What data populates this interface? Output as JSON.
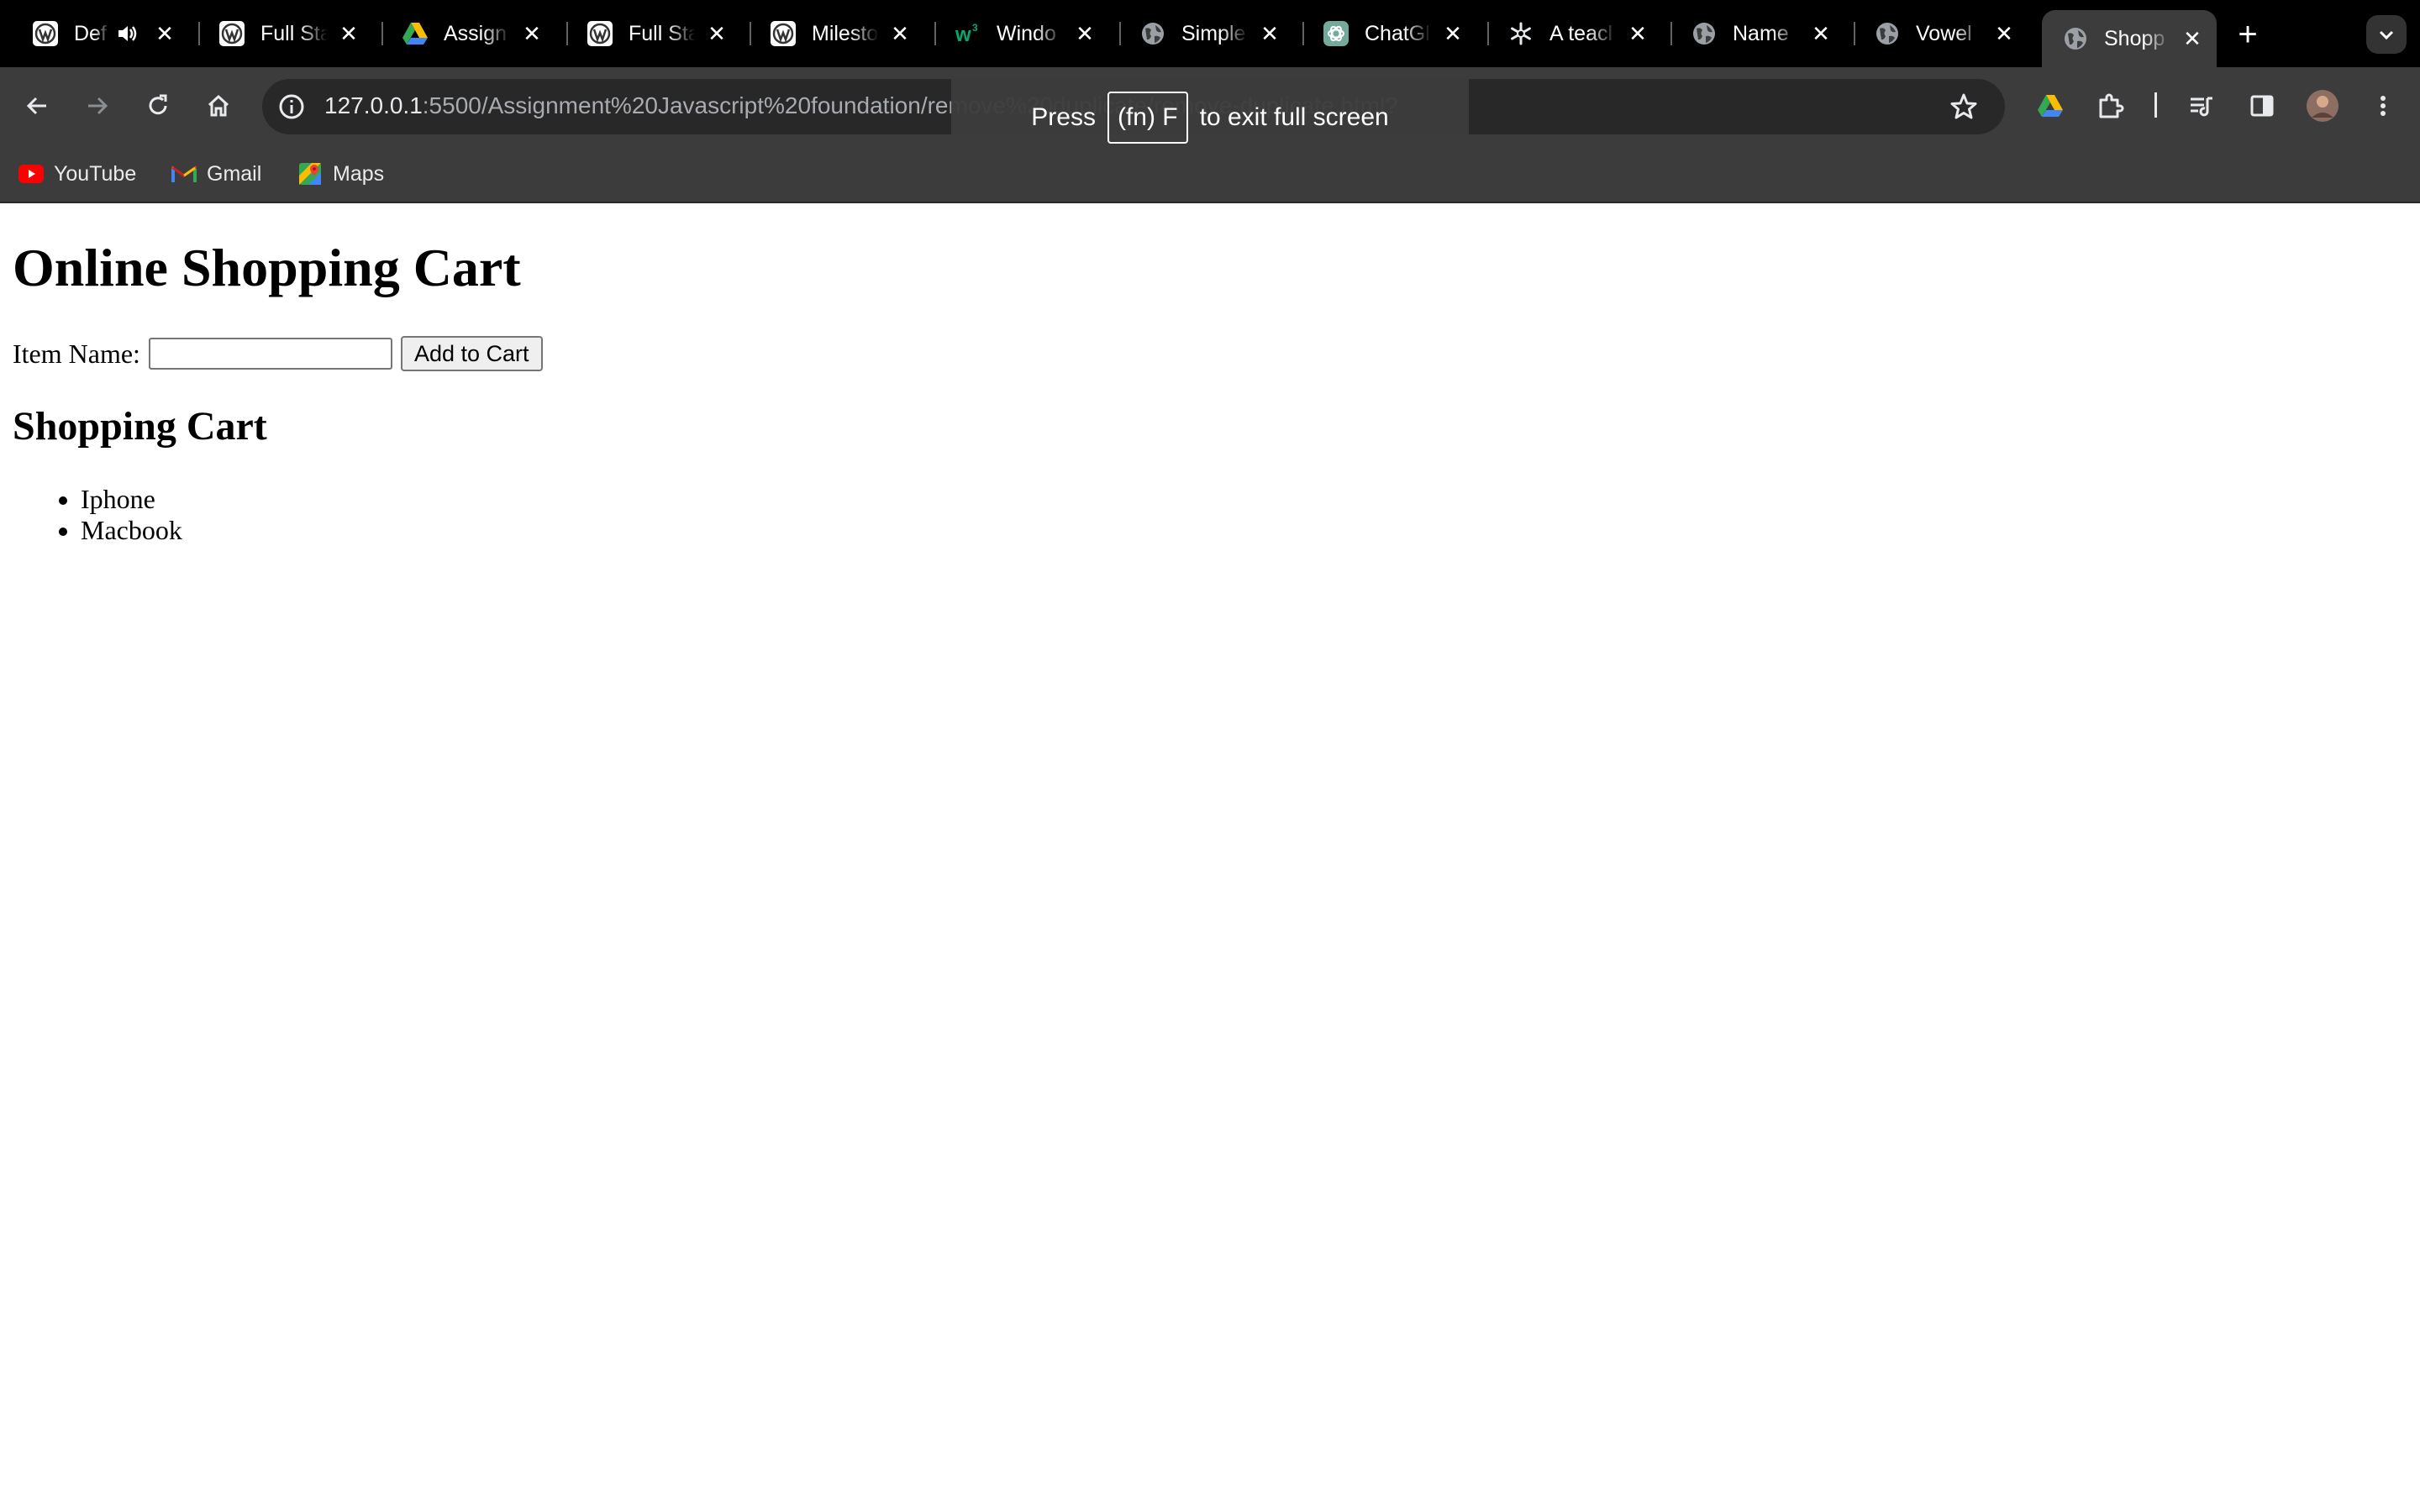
{
  "tabs": [
    {
      "title": "Def",
      "favicon": "wordpress-icon",
      "audio": true,
      "active": false
    },
    {
      "title": "Full Sta",
      "favicon": "wordpress-icon",
      "active": false
    },
    {
      "title": "Assign",
      "favicon": "drive-icon",
      "active": false
    },
    {
      "title": "Full Sta",
      "favicon": "wordpress-icon",
      "active": false
    },
    {
      "title": "Milesto",
      "favicon": "wordpress-icon",
      "active": false
    },
    {
      "title": "Windo",
      "favicon": "w3schools-icon",
      "active": false
    },
    {
      "title": "Simple",
      "favicon": "globe-icon",
      "active": false
    },
    {
      "title": "ChatGl",
      "favicon": "chatgpt-icon",
      "active": false
    },
    {
      "title": "A teacl",
      "favicon": "asterisk-icon",
      "active": false
    },
    {
      "title": "Name",
      "favicon": "globe-icon",
      "active": false
    },
    {
      "title": "Vowel",
      "favicon": "globe-icon",
      "active": false
    },
    {
      "title": "Shopp",
      "favicon": "globe-icon",
      "active": true
    }
  ],
  "address_bar": {
    "host": "127.0.0.1",
    "path": ":5500/Assignment%20Javascript%20foundation/remove%20duplicate/remove-duplicate.html?"
  },
  "bookmarks": [
    {
      "label": "YouTube",
      "icon": "youtube-icon"
    },
    {
      "label": "Gmail",
      "icon": "gmail-icon"
    },
    {
      "label": "Maps",
      "icon": "maps-icon"
    }
  ],
  "fullscreen_toast": {
    "prefix": "Press",
    "key": "(fn) F",
    "suffix": "to exit full screen"
  },
  "page": {
    "title": "Online Shopping Cart",
    "item_label": "Item Name:",
    "item_value": "",
    "add_button": "Add to Cart",
    "cart_heading": "Shopping Cart",
    "cart_items": [
      "Iphone",
      "Macbook"
    ]
  },
  "colors": {
    "tabstrip_bg": "#000000",
    "toolbar_bg": "#3c3c3c",
    "omnibox_bg": "#282828",
    "page_bg": "#ffffff"
  }
}
